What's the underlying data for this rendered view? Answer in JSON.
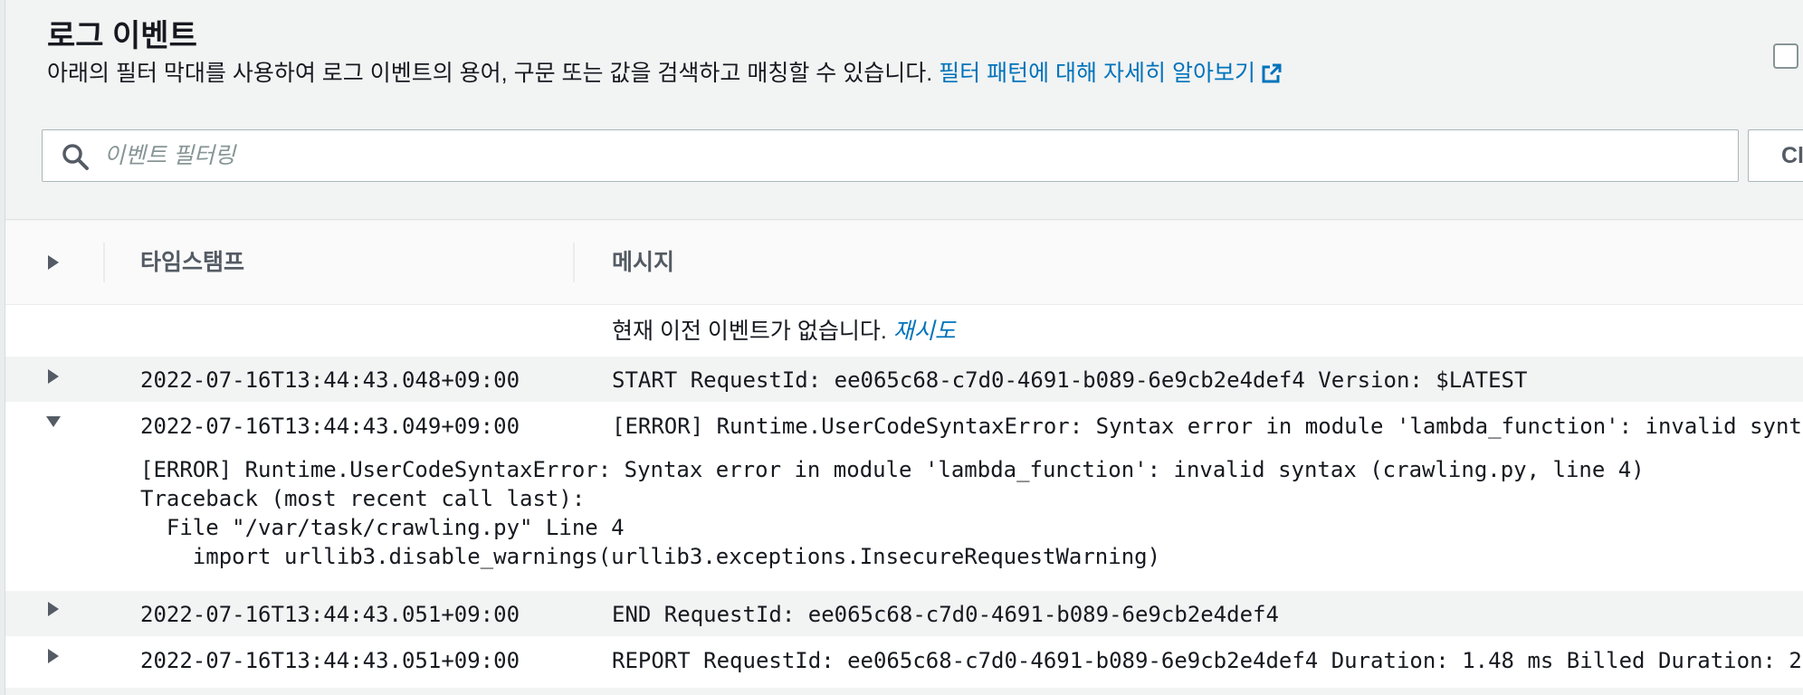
{
  "header": {
    "title": "로그 이벤트",
    "description": "아래의 필터 막대를 사용하여 로그 이벤트의 용어, 구문 또는 값을 검색하고 매칭할 수 있습니다.",
    "learn_more_link": "필터 패턴에 대해 자세히 알아보기",
    "search_placeholder": "이벤트 필터링",
    "search_value": "",
    "clear_button_label": "Cl"
  },
  "table": {
    "columns": [
      "타임스탬프",
      "메시지"
    ],
    "empty_notice": "현재 이전 이벤트가 없습니다.",
    "retry_link": "재시도",
    "rows": [
      {
        "timestamp": "2022-07-16T13:44:43.048+09:00",
        "message": "START RequestId: ee065c68-c7d0-4691-b089-6e9cb2e4def4 Version: $LATEST",
        "expanded": false
      },
      {
        "timestamp": "2022-07-16T13:44:43.049+09:00",
        "message": "[ERROR] Runtime.UserCodeSyntaxError: Syntax error in module 'lambda_function': invalid synta",
        "expanded": true,
        "detail": [
          "[ERROR] Runtime.UserCodeSyntaxError: Syntax error in module 'lambda_function': invalid syntax (crawling.py, line 4)",
          "Traceback (most recent call last):",
          "  File \"/var/task/crawling.py\" Line 4",
          "    import urllib3.disable_warnings(urllib3.exceptions.InsecureRequestWarning)"
        ]
      },
      {
        "timestamp": "2022-07-16T13:44:43.051+09:00",
        "message": "END RequestId: ee065c68-c7d0-4691-b089-6e9cb2e4def4",
        "expanded": false
      },
      {
        "timestamp": "2022-07-16T13:44:43.051+09:00",
        "message": "REPORT RequestId: ee065c68-c7d0-4691-b089-6e9cb2e4def4 Duration: 1.48 ms Billed Duration: 2",
        "expanded": false
      }
    ]
  },
  "icons": {
    "search": "search-icon",
    "external_link": "external-link-icon",
    "expand": "caret-right-icon",
    "collapse": "caret-down-icon"
  },
  "colors": {
    "link": "#0073bb",
    "text": "#16191f",
    "muted": "#545b64",
    "background": "#f2f3f3"
  }
}
